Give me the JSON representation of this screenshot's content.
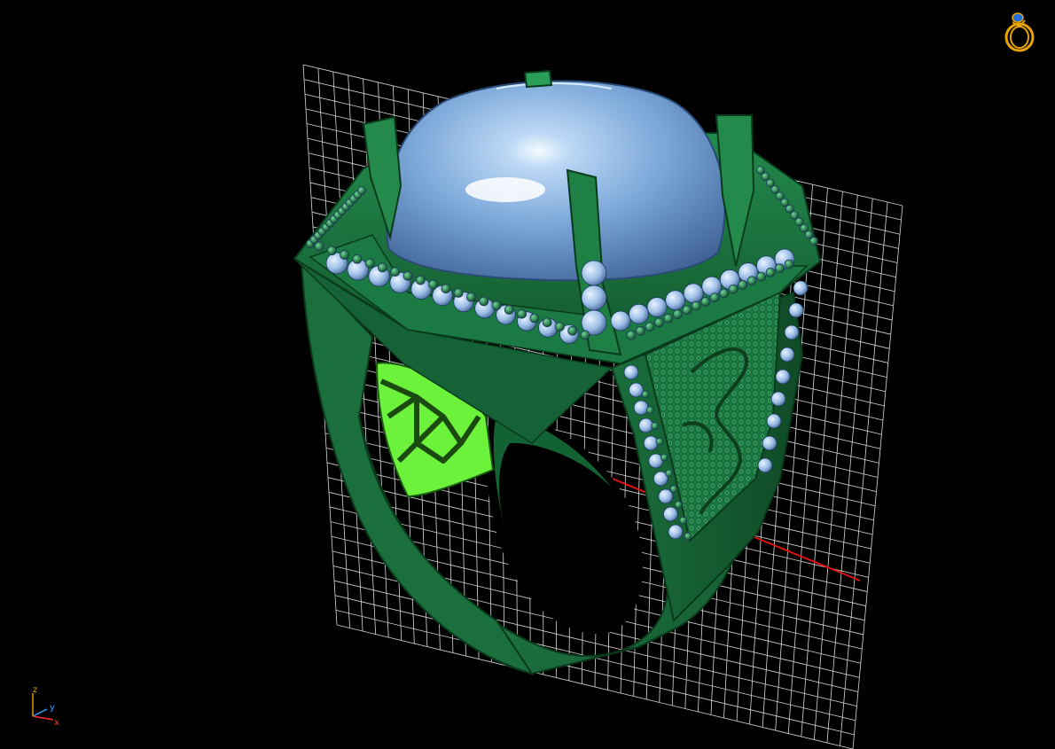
{
  "viewport": {
    "background_color": "#000000",
    "grid_color": "#d8d8d8",
    "x_axis_color": "#e01010",
    "ring_metal_color": "#1e7a44",
    "gemstone_color": "#7aa6d8",
    "highlight_color": "#8bff4a"
  },
  "axis_triad": {
    "z_label": "z",
    "y_label": "y",
    "x_label": "x",
    "z_color": "#d8a000",
    "y_color": "#2fa0ff",
    "x_color": "#ff3030"
  },
  "view_cube": {
    "icon": "ring-icon",
    "color": "#e8a400",
    "accent_color": "#1f6fd8"
  }
}
